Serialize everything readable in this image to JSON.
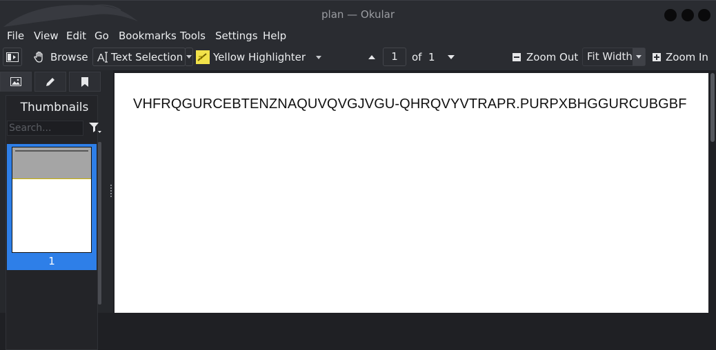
{
  "window": {
    "title": "plan — Okular"
  },
  "menubar": {
    "items": [
      {
        "label": "File"
      },
      {
        "label": "View"
      },
      {
        "label": "Edit"
      },
      {
        "label": "Go"
      },
      {
        "label": "Bookmarks"
      },
      {
        "label": "Tools"
      },
      {
        "label": "Settings"
      },
      {
        "label": "Help"
      }
    ]
  },
  "toolbar": {
    "browse_label": "Browse",
    "text_selection_label": "Text Selection",
    "highlighter_label": "Yellow Highlighter",
    "page_current": "1",
    "page_of_label": "of",
    "page_total": "1",
    "zoom_out_label": "Zoom Out",
    "zoom_mode": "Fit Width",
    "zoom_in_label": "Zoom In"
  },
  "sidebar": {
    "title": "Thumbnails",
    "search_placeholder": "Search...",
    "thumbnails": [
      {
        "page_label": "1",
        "selected": true
      }
    ]
  },
  "document": {
    "text": "VHFRQGURCEBTENZNAQUVQVGJVGU-QHRQVYVTRAPR.PURPXBHGGURCUBGBF"
  },
  "colors": {
    "accent": "#2e7fe8",
    "highlight_yellow": "#f2e24a"
  }
}
